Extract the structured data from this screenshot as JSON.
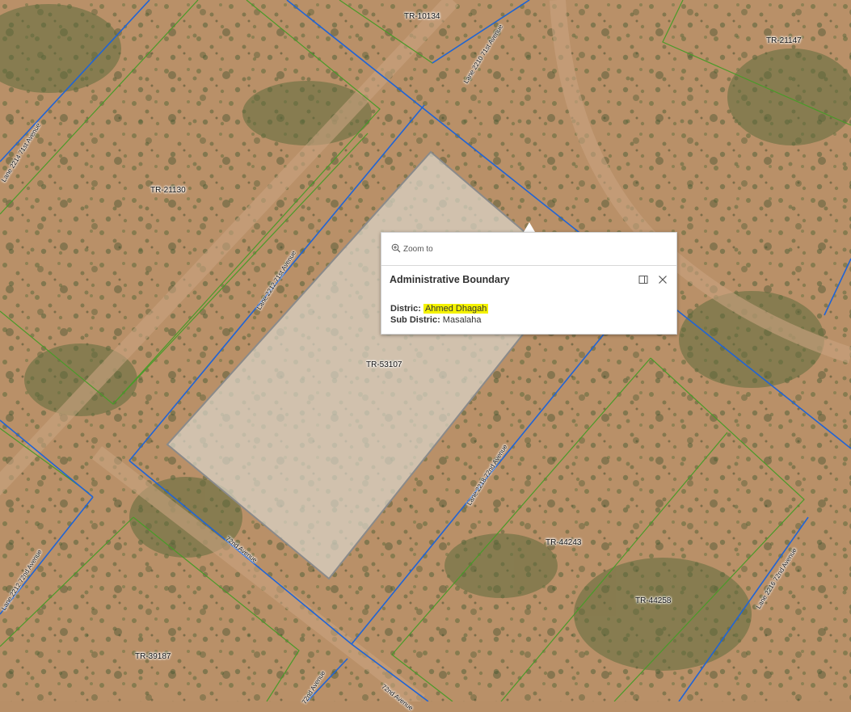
{
  "map": {
    "parcels": [
      "TR-10134",
      "TR-21147",
      "TR-21130",
      "TR-53107",
      "TR-44243",
      "TR-44258",
      "TR-39187"
    ],
    "streets": [
      "Lane 2210 71st Avenue",
      "Lane 2214 71st Avenue",
      "Lane 2212 71st Avenue",
      "Lane 2218 72nd Avenue",
      "Lane 2216 72nd Avenue",
      "Lane 2212 72nd Avenue",
      "72nd Avenue",
      "72nd Avenue",
      "72nd Avenue"
    ],
    "colors": {
      "blue_lines": "#1f64d6",
      "green_lines": "#4a9a2a",
      "highlight": "#f4f200"
    }
  },
  "popup": {
    "zoom_label": "Zoom to",
    "title": "Administrative Boundary",
    "fields": [
      {
        "name": "Distric:",
        "value": "Ahmed Dhagah"
      },
      {
        "name": "Sub Distric:",
        "value": "Masalaha"
      }
    ],
    "icons": {
      "zoom": "zoom-in-icon",
      "dock": "dock-icon",
      "close": "close-icon"
    }
  }
}
